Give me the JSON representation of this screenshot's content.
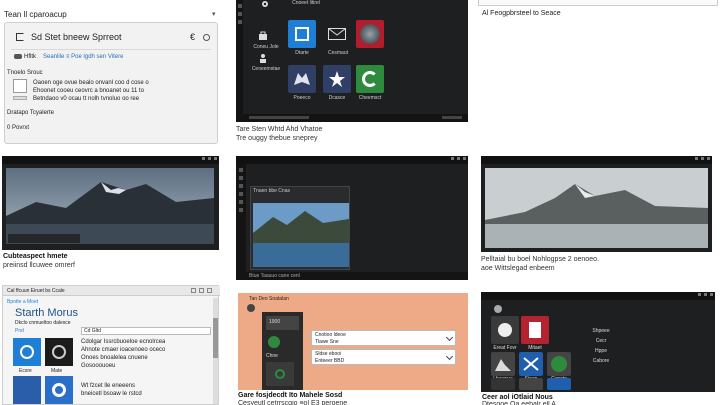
{
  "col1": {
    "panel": {
      "title": "Tean ll cparoacup",
      "chev": "▾",
      "card_title": "Sd Stet bneew Sprreot",
      "pill_label": "Hfltk",
      "link": "Seanlile ≡ Poe lgdh sen Vitere",
      "section": "Tnoelo Srouc",
      "desc_lines": [
        "Oaoen oge ovue bealo onvanl coo d cose o",
        "Ehoonet cooeu ceovrc a bnoanet ou 11 to",
        "Betndaoo v0 ocau tt nolh tvnoluo oo ree"
      ],
      "status": "Dratapo Tcyalerte",
      "count": "0 Povrxt"
    },
    "shot2": {
      "cap1": "Cubteaspect hmete",
      "cap2": "preiinsd llcuwee omrerf"
    },
    "shot3": {
      "header": "Cal ffcuun Eiruet bs Ccale",
      "subhdr": "Bpotte a Moet",
      "title": "Starth Morus",
      "sub1": "Dkclo cnmueltoo dalesce",
      "tag": "Pnd",
      "search": "Cd Gltd",
      "item1": "Ecsre",
      "item2": "Mate",
      "body_lines": [
        "Cdolgar Issrcbuoeloe ecnolrcea",
        "Ahnote cmaer ioacenoeo oceco",
        "Onoes bnoalelea cnuene",
        "Gosooouoeu",
        "Wt fzcet lle eneeens",
        "bneicetl bsoaw le rstcd"
      ]
    }
  },
  "col2": {
    "shot1": {
      "tiles": [
        "Cnoeet litirel",
        "Coneu Jole",
        "Ceoeemstae",
        "Dtarte",
        "Cesmaut",
        "Poeeco",
        "Dcasce",
        "Cheemsct"
      ],
      "cap1": "Tare Sten Whtd Ahd Vhatoe",
      "cap2": "Tre ouggy thebue sneprey"
    },
    "shot2": {
      "inner_title": "Tnaen bbe Cnas",
      "status_text": "Btue Taauuo cane cenl"
    },
    "shot3": {
      "header": "Tan Deo Soatalan",
      "field_top": "1900",
      "field_bottom": "Chne",
      "row1_line1": "Cnotioo ldeoe",
      "row1_line2": "Tlawe Sne",
      "row2_line1": "Sldse ebooi",
      "row2_line2": "Enteeer BBD",
      "cap1": "Gare fosjdecdt Ito Mahele Sosd",
      "cap2": "Cesyeutl cetrrscgio ≡ol E3 peroene"
    }
  },
  "col3": {
    "bar1": "Al Feogpbrsteel to Seace",
    "shot2": {
      "cap1": "Pelltaial bu boel Nohlogpse 2 oenoeo.",
      "cap2": "aoe Wittslegad enbeem"
    },
    "shot3": {
      "tiles": [
        "Ereat Fovr",
        "Mitaet",
        "Lbaunue",
        "Sioen",
        "Ggsste",
        "Shpeee",
        "Cecr",
        "Hppe",
        "Cabore"
      ],
      "cap1": "Ceer aol iOtlaid Nous",
      "cap2": "Dtesgoe Oa eebalr ell A"
    }
  },
  "colors": {
    "dark_bg": "#1e1f20",
    "accent_blue": "#1f7fd6",
    "orange_bg": "#eea986",
    "green_tile": "#2e8b3e"
  }
}
